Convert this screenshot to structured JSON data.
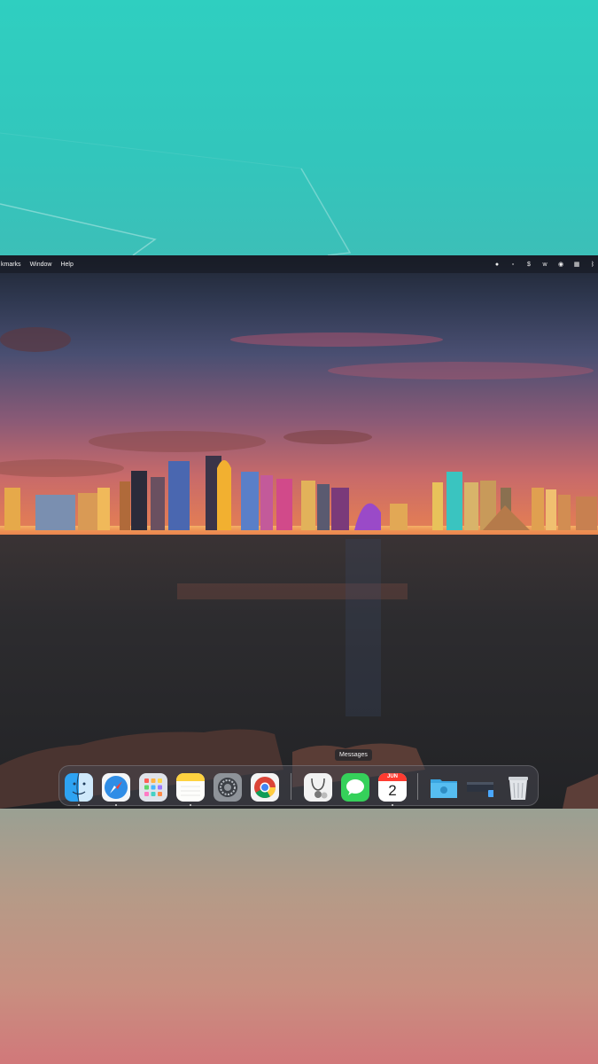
{
  "menubar": {
    "items": [
      "kmarks",
      "Window",
      "Help"
    ]
  },
  "dock": {
    "tooltip": "Messages",
    "calendar": {
      "month": "JUN",
      "day": "2"
    },
    "apps": [
      "finder-icon",
      "safari-icon",
      "launchpad-icon",
      "notes-icon",
      "system-settings-icon",
      "chrome-icon",
      "preview-icon",
      "messages-icon",
      "calendar-icon",
      "downloads-folder-icon",
      "minimized-window-icon",
      "trash-icon"
    ]
  },
  "colors": {
    "top_band": "#2fcfc0",
    "bottom_band_end": "#d1787a"
  }
}
